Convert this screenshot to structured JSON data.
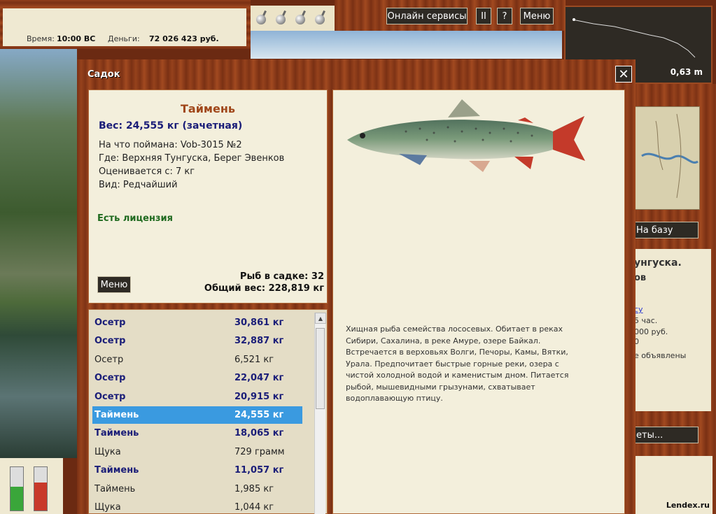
{
  "status": {
    "time_label": "Время:",
    "time_value": "10:00 ВС",
    "money_label": "Деньги:",
    "money_value": "72 026 423 руб."
  },
  "toolbar": {
    "online_label": "Онлайн сервисы",
    "pause_label": "II",
    "help_label": "?",
    "menu_label": "Меню"
  },
  "minimap": {
    "distance": "0,63 m"
  },
  "side": {
    "base_label": "На базу",
    "info_line1": "унгуска.",
    "info_line2": "ов",
    "info_link": "су",
    "info_line3": "5 час.",
    "info_line4": "000 руб.",
    "info_line5": "0",
    "info_line6": "е объявлены",
    "reports_label": "еты...",
    "watermark": "Lendex.ru"
  },
  "window": {
    "title": "Садок",
    "close": "✕"
  },
  "fish": {
    "name": "Таймень",
    "weight": "Вес: 24,555 кг (зачетная)",
    "caught_on": "На что поймана: Vob-3015 №2",
    "where": "Где: Верхняя Тунгуска, Берег Эвенков",
    "value_from": "Оценивается с: 7 кг",
    "rarity": "Вид: Редчайший",
    "license": "Есть лицензия",
    "menu_label": "Меню",
    "count": "Рыб в садке: 32",
    "total_weight": "Общий вес: 228,819 кг",
    "description": "Хищная рыба семейства лососевых. Обитает в реках Сибири, Сахалина, в реке Амуре, озере Байкал. Встречается в верховьях Волги, Печоры, Камы, Вятки, Урала. Предпочитает быстрые горные реки, озера с чистой холодной водой и каменистым дном. Питается рыбой, мышевидными грызунами, схватывает водоплавающую птицу."
  },
  "catch_list": [
    {
      "name": "Осетр",
      "weight": "30,861 кг",
      "style": "bold"
    },
    {
      "name": "Осетр",
      "weight": "32,887 кг",
      "style": "bold"
    },
    {
      "name": "Осетр",
      "weight": "6,521 кг",
      "style": "norm"
    },
    {
      "name": "Осетр",
      "weight": "22,047 кг",
      "style": "bold"
    },
    {
      "name": "Осетр",
      "weight": "20,915 кг",
      "style": "bold"
    },
    {
      "name": "Таймень",
      "weight": "24,555 кг",
      "style": "sel"
    },
    {
      "name": "Таймень",
      "weight": "18,065 кг",
      "style": "bold"
    },
    {
      "name": "Щука",
      "weight": "729 грамм",
      "style": "norm"
    },
    {
      "name": "Таймень",
      "weight": "11,057 кг",
      "style": "bold"
    },
    {
      "name": "Таймень",
      "weight": "1,985 кг",
      "style": "norm"
    },
    {
      "name": "Щука",
      "weight": "1,044 кг",
      "style": "norm"
    }
  ],
  "gauges": [
    {
      "level": 0.55,
      "color": "#3aa63a"
    },
    {
      "level": 0.65,
      "color": "#c8392a"
    }
  ]
}
